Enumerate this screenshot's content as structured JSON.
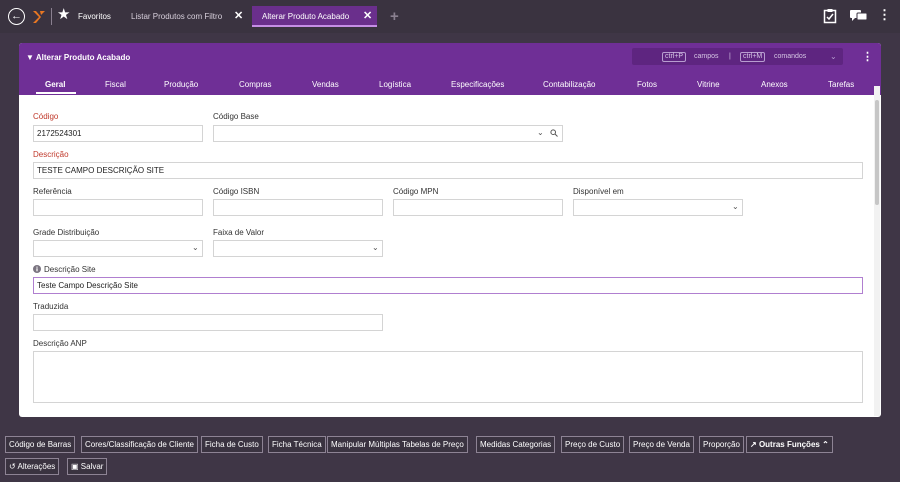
{
  "topbar": {
    "favorites_label": "Favoritos",
    "tabs": [
      {
        "label": "Listar Produtos com Filtro"
      },
      {
        "label": "Alterar Produto Acabado"
      }
    ]
  },
  "panel": {
    "title": "Alterar Produto Acabado",
    "shortcut_fields_key": "ctrl+P",
    "shortcut_fields_label": "campos",
    "shortcut_separator": "|",
    "shortcut_commands_key": "ctrl+M",
    "shortcut_commands_label": "comandos",
    "tabs": [
      "Geral",
      "Fiscal",
      "Produção",
      "Compras",
      "Vendas",
      "Logística",
      "Especificações",
      "Contabilização",
      "Fotos",
      "Vitrine",
      "Anexos",
      "Tarefas"
    ]
  },
  "form": {
    "codigo": {
      "label": "Código",
      "value": "2172524301"
    },
    "codigo_base": {
      "label": "Código Base",
      "value": ""
    },
    "descricao": {
      "label": "Descrição",
      "value": "TESTE CAMPO DESCRIÇÃO SITE"
    },
    "referencia": {
      "label": "Referência",
      "value": ""
    },
    "codigo_isbn": {
      "label": "Código ISBN",
      "value": ""
    },
    "codigo_mpn": {
      "label": "Código MPN",
      "value": ""
    },
    "disponivel_em": {
      "label": "Disponível em",
      "value": ""
    },
    "grade_distribuicao": {
      "label": "Grade Distribuição",
      "value": ""
    },
    "faixa_valor": {
      "label": "Faixa de Valor",
      "value": ""
    },
    "descricao_site": {
      "label": "Descrição Site",
      "value": "Teste Campo Descrição Site"
    },
    "traduzida": {
      "label": "Traduzida",
      "value": ""
    },
    "descricao_anp": {
      "label": "Descrição ANP",
      "value": ""
    }
  },
  "bottom": {
    "functions": [
      "Código de Barras",
      "Cores/Classificação de Cliente",
      "Ficha de Custo",
      "Ficha Técnica",
      "Manipular Múltiplas Tabelas de Preço",
      "Medidas Categorias",
      "Preço de Custo",
      "Preço de Venda",
      "Proporção"
    ],
    "other_functions": "Outras Funções",
    "changes": "Alterações",
    "save": "Salvar"
  },
  "colors": {
    "accent": "#6f2f96",
    "top_bar": "#3a3340",
    "active_tab": "#6a2f8c",
    "required": "#c0392b"
  }
}
